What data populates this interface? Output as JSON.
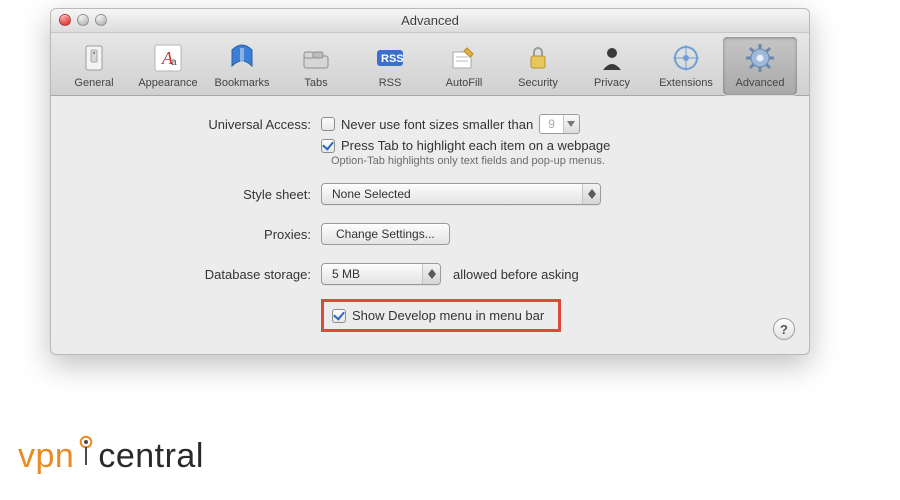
{
  "window": {
    "title": "Advanced"
  },
  "toolbar": {
    "items": [
      {
        "label": "General"
      },
      {
        "label": "Appearance"
      },
      {
        "label": "Bookmarks"
      },
      {
        "label": "Tabs"
      },
      {
        "label": "RSS"
      },
      {
        "label": "AutoFill"
      },
      {
        "label": "Security"
      },
      {
        "label": "Privacy"
      },
      {
        "label": "Extensions"
      },
      {
        "label": "Advanced"
      }
    ]
  },
  "universal_access": {
    "label": "Universal Access:",
    "never_smaller_label": "Never use font sizes smaller than",
    "never_smaller_value": "9",
    "press_tab_label": "Press Tab to highlight each item on a webpage",
    "press_tab_help": "Option-Tab highlights only text fields and pop-up menus."
  },
  "stylesheet": {
    "label": "Style sheet:",
    "value": "None Selected"
  },
  "proxies": {
    "label": "Proxies:",
    "button": "Change Settings..."
  },
  "database": {
    "label": "Database storage:",
    "value": "5 MB",
    "trailing": "allowed before asking"
  },
  "develop": {
    "label": "Show Develop menu in menu bar"
  },
  "help": {
    "symbol": "?"
  },
  "brand": {
    "a": "vpn",
    "b": "central"
  }
}
